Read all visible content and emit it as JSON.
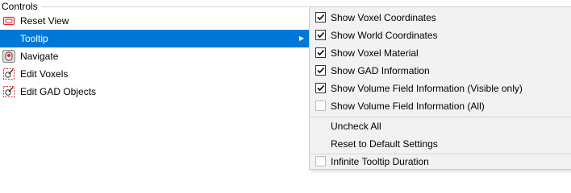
{
  "controls": {
    "title": "Controls",
    "items": [
      {
        "label": "Reset View",
        "icon": "reset-view-icon"
      },
      {
        "label": "Tooltip",
        "icon": "none",
        "selected": true
      },
      {
        "label": "Navigate",
        "icon": "navigate-icon"
      },
      {
        "label": "Edit Voxels",
        "icon": "edit-voxels-icon"
      },
      {
        "label": "Edit GAD Objects",
        "icon": "edit-gad-objects-icon"
      }
    ]
  },
  "tooltip_menu": {
    "items": [
      {
        "label": "Show Voxel Coordinates",
        "checked": true
      },
      {
        "label": "Show World Coordinates",
        "checked": true
      },
      {
        "label": "Show Voxel Material",
        "checked": true
      },
      {
        "label": "Show GAD Information",
        "checked": true
      },
      {
        "label": "Show Volume Field Information (Visible only)",
        "checked": true
      },
      {
        "label": "Show Volume Field Information (All)",
        "checked": false
      },
      {
        "label": "Uncheck All"
      },
      {
        "label": "Reset to Default Settings"
      },
      {
        "label": "Infinite Tooltip Duration",
        "checked": false
      }
    ]
  },
  "colors": {
    "selection": "#0078d7",
    "menu_background": "#f2f2f2",
    "icon_red": "#e0262b"
  }
}
